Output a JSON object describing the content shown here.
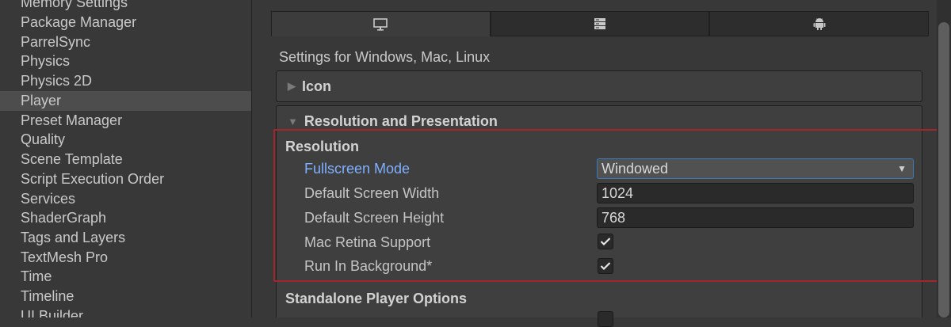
{
  "sidebar": {
    "items": [
      {
        "label": "Memory Settings"
      },
      {
        "label": "Package Manager"
      },
      {
        "label": "ParrelSync"
      },
      {
        "label": "Physics"
      },
      {
        "label": "Physics 2D"
      },
      {
        "label": "Player",
        "selected": true
      },
      {
        "label": "Preset Manager"
      },
      {
        "label": "Quality"
      },
      {
        "label": "Scene Template"
      },
      {
        "label": "Script Execution Order"
      },
      {
        "label": "Services"
      },
      {
        "label": "ShaderGraph"
      },
      {
        "label": "Tags and Layers"
      },
      {
        "label": "TextMesh Pro"
      },
      {
        "label": "Time"
      },
      {
        "label": "Timeline"
      },
      {
        "label": "UI Builder"
      }
    ]
  },
  "platform_tabs": [
    {
      "icon": "monitor-icon",
      "active": true
    },
    {
      "icon": "server-icon",
      "active": false
    },
    {
      "icon": "android-icon",
      "active": false
    }
  ],
  "settings_for": "Settings for Windows, Mac, Linux",
  "foldouts": {
    "icon": {
      "label": "Icon",
      "expanded": false
    },
    "resolution": {
      "label": "Resolution and Presentation",
      "expanded": true
    }
  },
  "resolution": {
    "heading": "Resolution",
    "fullscreen_mode": {
      "label": "Fullscreen Mode",
      "value": "Windowed"
    },
    "default_width": {
      "label": "Default Screen Width",
      "value": "1024"
    },
    "default_height": {
      "label": "Default Screen Height",
      "value": "768"
    },
    "mac_retina": {
      "label": "Mac Retina Support",
      "checked": true
    },
    "run_in_background": {
      "label": "Run In Background*",
      "checked": true
    }
  },
  "standalone": {
    "heading": "Standalone Player Options"
  },
  "colors": {
    "background": "#383838",
    "selection": "#4d4d4d",
    "focus_label": "#7fb0ff",
    "highlight_border": "#a3262b"
  }
}
